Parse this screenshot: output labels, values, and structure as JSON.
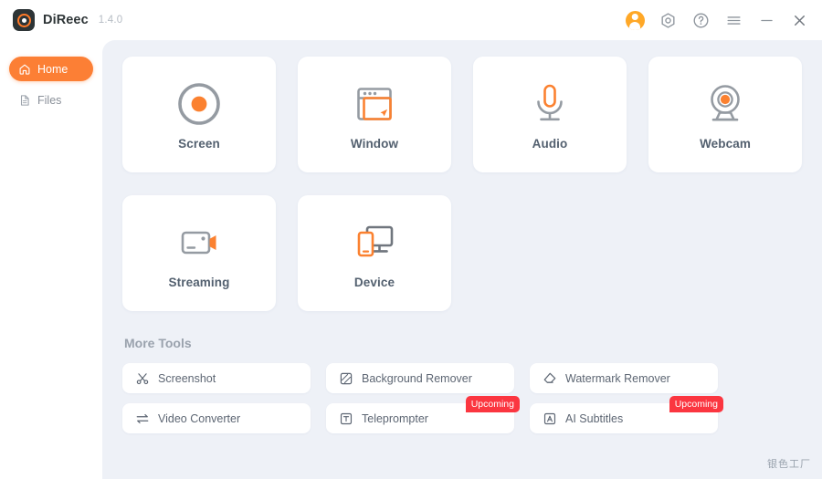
{
  "titlebar": {
    "app_name": "DiReec",
    "version": "1.4.0",
    "logo_icon": "record-logo-icon",
    "actions": [
      {
        "name": "account-avatar",
        "icon": "user-avatar-icon",
        "label": ""
      },
      {
        "name": "settings-button",
        "icon": "hexagon-settings-icon",
        "label": ""
      },
      {
        "name": "help-button",
        "icon": "question-circle-icon",
        "label": ""
      },
      {
        "name": "menu-button",
        "icon": "hamburger-menu-icon",
        "label": ""
      },
      {
        "name": "minimize-button",
        "icon": "minimize-icon",
        "label": ""
      },
      {
        "name": "close-button",
        "icon": "close-icon",
        "label": ""
      }
    ]
  },
  "sidebar": {
    "items": [
      {
        "label": "Home",
        "icon": "home-icon",
        "active": true
      },
      {
        "label": "Files",
        "icon": "file-document-icon",
        "active": false
      }
    ]
  },
  "main": {
    "cards": [
      {
        "label": "Screen",
        "icon": "record-circle-icon"
      },
      {
        "label": "Window",
        "icon": "window-select-icon"
      },
      {
        "label": "Audio",
        "icon": "microphone-icon"
      },
      {
        "label": "Webcam",
        "icon": "webcam-icon"
      },
      {
        "label": "Streaming",
        "icon": "video-camera-icon"
      },
      {
        "label": "Device",
        "icon": "phone-monitor-icon"
      }
    ],
    "more_tools_title": "More Tools",
    "tools": [
      {
        "label": "Screenshot",
        "icon": "scissors-icon",
        "badge": ""
      },
      {
        "label": "Background Remover",
        "icon": "hatched-square-icon",
        "badge": ""
      },
      {
        "label": "Watermark Remover",
        "icon": "eraser-icon",
        "badge": ""
      },
      {
        "label": "Video Converter",
        "icon": "exchange-arrows-icon",
        "badge": ""
      },
      {
        "label": "Teleprompter",
        "icon": "boxed-t-icon",
        "badge": "Upcoming"
      },
      {
        "label": "AI Subtitles",
        "icon": "boxed-a-icon",
        "badge": "Upcoming"
      }
    ]
  },
  "watermark": {
    "text": "银色工厂"
  },
  "colors": {
    "accent": "#fc7f35",
    "accent_light": "#ffa827",
    "badge_red": "#fb3640",
    "content_bg": "#eef1f7",
    "card_bg": "#ffffff",
    "text_dark": "#53606f",
    "text_muted": "#9aa2ad",
    "icon_gray": "#8d949c"
  }
}
